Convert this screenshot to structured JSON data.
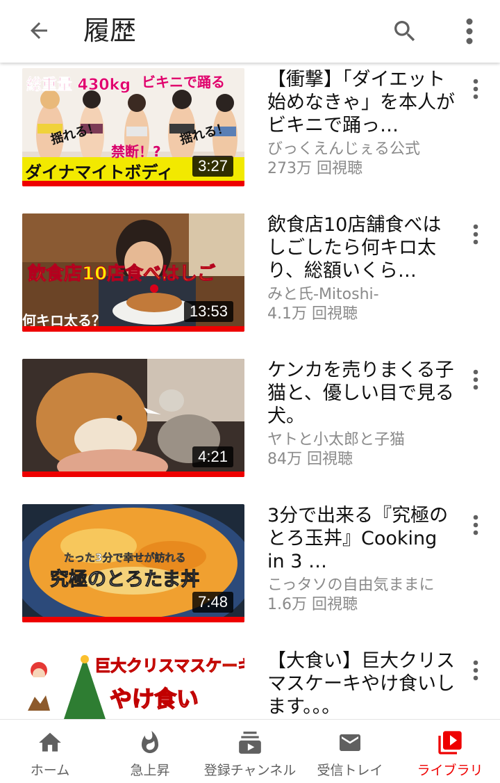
{
  "header": {
    "title": "履歴"
  },
  "videos": [
    {
      "title": "【衝撃】「ダイエット始めなきゃ」を本人がビキニで踊っ…",
      "channel": "びっくえんじぇる公式",
      "views": "273万 回視聴",
      "duration": "3:27",
      "thumb_texts": [
        "総重量 430kg",
        "ビキニで踊る",
        "揺れる！",
        "禁断！?",
        "揺れる！",
        "ダイナマイトボディ"
      ]
    },
    {
      "title": "飲食店10店舗食べはしごしたら何キロ太り、総額いくら…",
      "channel": "みと氏-Mitoshi-",
      "views": "4.1万 回視聴",
      "duration": "13:53",
      "thumb_texts": [
        "飲食店10店食べはしご",
        "何キロ太る？"
      ]
    },
    {
      "title": "ケンカを売りまくる子猫と、優しい目で見る犬。",
      "channel": "ヤトと小太郎と子猫",
      "views": "84万 回視聴",
      "duration": "4:21",
      "thumb_texts": []
    },
    {
      "title": "3分で出来る『究極のとろ玉丼』Cooking in 3 …",
      "channel": "こっタソの自由気ままに",
      "views": "1.6万 回視聴",
      "duration": "7:48",
      "thumb_texts": [
        "たった3分で幸せが訪れる",
        "究極のとろたま丼"
      ]
    },
    {
      "title": "【大食い】巨大クリスマスケーキやけ食いします。。。",
      "channel": "",
      "views": "",
      "duration": "",
      "thumb_texts": [
        "巨大クリスマスケーキ",
        "やけ食い"
      ]
    }
  ],
  "nav": [
    {
      "label": "ホーム",
      "icon": "home-icon"
    },
    {
      "label": "急上昇",
      "icon": "fire-icon"
    },
    {
      "label": "登録チャンネル",
      "icon": "subscriptions-icon"
    },
    {
      "label": "受信トレイ",
      "icon": "inbox-icon"
    },
    {
      "label": "ライブラリ",
      "icon": "library-icon",
      "active": true
    }
  ],
  "colors": {
    "accent": "#ee0000",
    "icon": "#606060",
    "text_secondary": "#8a8a8a"
  }
}
